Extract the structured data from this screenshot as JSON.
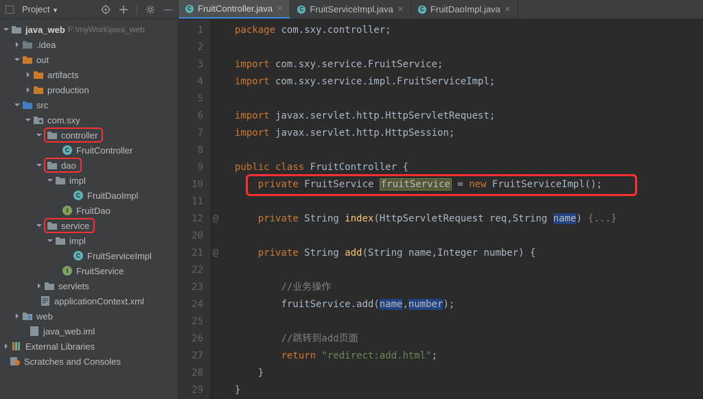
{
  "toolbar": {
    "project_label": "Project"
  },
  "tree": {
    "root": "java_web",
    "root_path": "F:\\myWork\\java_web",
    "idea": ".idea",
    "out": "out",
    "artifacts": "artifacts",
    "production": "production",
    "src": "src",
    "pkg": "com.sxy",
    "controller": "controller",
    "fruitController": "FruitController",
    "dao": "dao",
    "impl1": "impl",
    "fruitDaoImpl": "FruitDaoImpl",
    "fruitDao": "FruitDao",
    "service": "service",
    "impl2": "impl",
    "fruitServiceImpl": "FruitServiceImpl",
    "fruitService": "FruitService",
    "servlets": "servlets",
    "appCtx": "applicationContext.xml",
    "web": "web",
    "iml": "java_web.iml",
    "extLib": "External Libraries",
    "scratches": "Scratches and Consoles"
  },
  "tabs": [
    {
      "name": "FruitController.java",
      "active": true
    },
    {
      "name": "FruitServiceImpl.java",
      "active": false
    },
    {
      "name": "FruitDaoImpl.java",
      "active": false
    }
  ],
  "gutter": [
    "1",
    "2",
    "3",
    "4",
    "5",
    "6",
    "7",
    "8",
    "9",
    "10",
    "11",
    "12",
    "20",
    "21",
    "22",
    "23",
    "24",
    "25",
    "26",
    "27",
    "28",
    "29"
  ],
  "gutmark": [
    "",
    "",
    "",
    "",
    "",
    "",
    "",
    "",
    "",
    "",
    "",
    "@",
    "",
    "@",
    "",
    "",
    "",
    "",
    "",
    "",
    "",
    ""
  ],
  "code": {
    "l1_kw": "package",
    "l1_rest": " com.sxy.controller;",
    "l3_kw": "import",
    "l3_rest": " com.sxy.service.FruitService;",
    "l4_kw": "import",
    "l4_rest": " com.sxy.service.impl.FruitServiceImpl;",
    "l6_kw": "import",
    "l6_rest": " javax.servlet.http.HttpServletRequest;",
    "l7_kw": "import",
    "l7_rest": " javax.servlet.http.HttpSession;",
    "l9_a": "public class ",
    "l9_b": "FruitController ",
    "l9_c": "{",
    "l10_a": "private ",
    "l10_b": "FruitService ",
    "l10_c": "fruitService",
    "l10_d": " = ",
    "l10_e": "new ",
    "l10_f": "FruitServiceImpl();",
    "l12_a": "private ",
    "l12_b": "String ",
    "l12_c": "index",
    "l12_d": "(HttpServletRequest req,String ",
    "l12_e": "name",
    "l12_f": ") ",
    "l12_g": "{...}",
    "l21_a": "private ",
    "l21_b": "String ",
    "l21_c": "add",
    "l21_d": "(String name,Integer number) {",
    "l23": "//业务操作",
    "l24_a": "fruitService.add(",
    "l24_b": "name",
    "l24_c": ",",
    "l24_d": "number",
    "l24_e": ");",
    "l26": "//跳转到add页面",
    "l27_a": "return ",
    "l27_b": "\"redirect:add.html\"",
    "l27_c": ";",
    "l28": "}",
    "l29": "}"
  }
}
